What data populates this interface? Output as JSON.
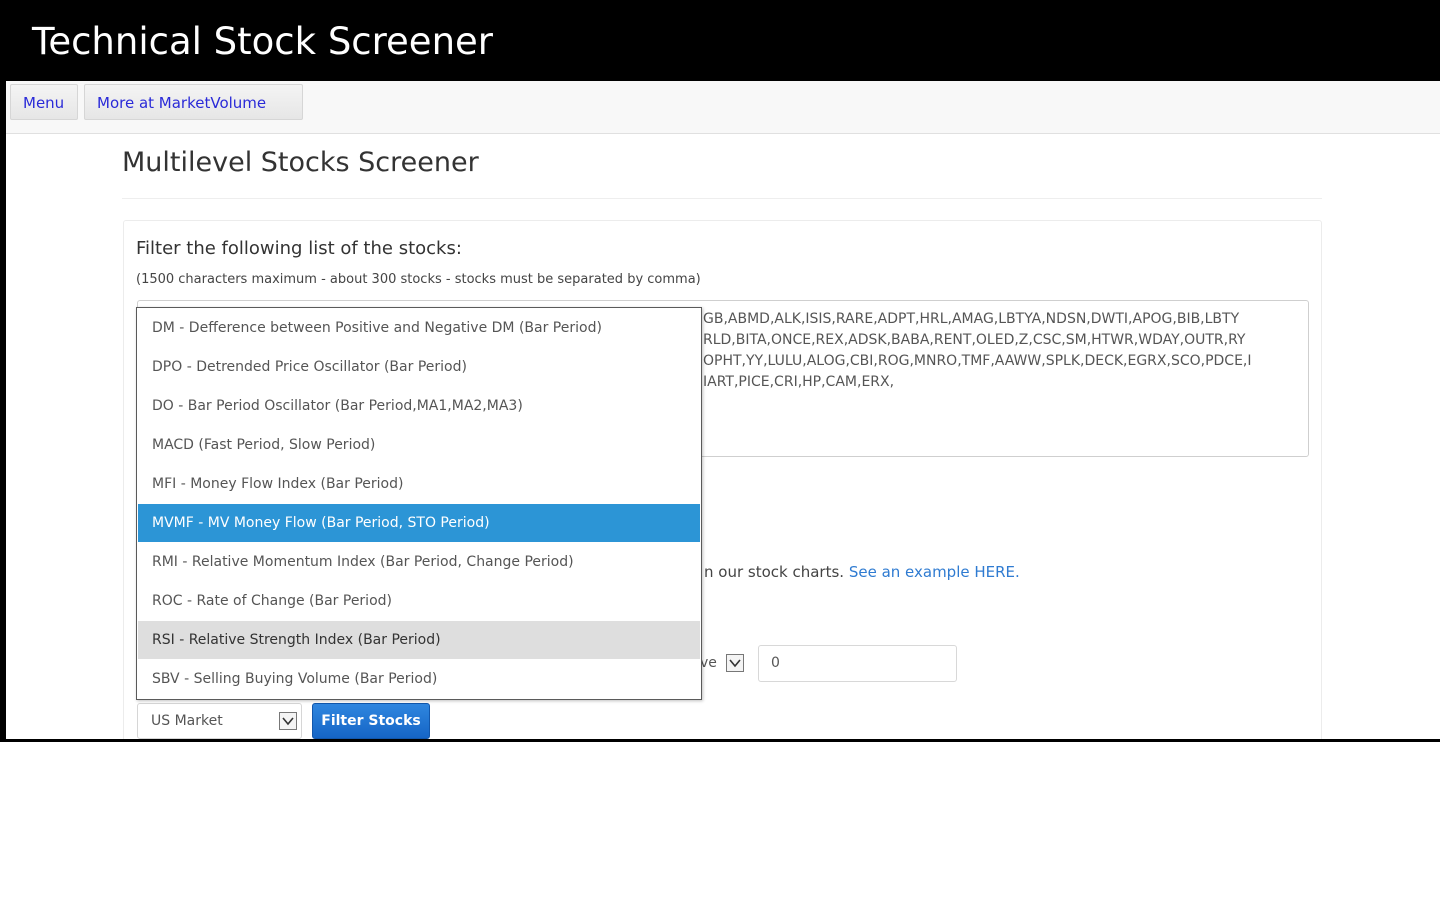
{
  "window": {
    "title": "Technical Stock Screener"
  },
  "nav": {
    "menu_label": "Menu",
    "more_label": "More at MarketVolume"
  },
  "page": {
    "heading": "Multilevel Stocks Screener",
    "filter_label": "Filter the following list of the stocks:",
    "filter_note": "(1500 characters maximum - about 300 stocks - stocks must be separated by comma)",
    "stock_list_visible": "GB,ABMD,ALK,ISIS,RARE,ADPT,HRL,AMAG,LBTYA,NDSN,DWTI,APOG,BIB,LBTY\nRLD,BITA,ONCE,REX,ADSK,BABA,RENT,OLED,Z,CSC,SM,HTWR,WDAY,OUTR,RY\nOPHT,YY,LULU,ALOG,CBI,ROG,MNRO,TMF,AAWW,SPLK,DECK,EGRX,SCO,PDCE,I\nIART,PICE,CRI,HP,CAM,ERX,"
  },
  "charts_line": {
    "text": "n our stock charts.",
    "link": "See an example HERE."
  },
  "condition": {
    "select_visible_text": "ve",
    "value": "0"
  },
  "market": {
    "selected": "US Market"
  },
  "filter_button": {
    "label": "Filter Stocks"
  },
  "indicator_dropdown": {
    "selected_index": 5,
    "hover_index": 8,
    "options": [
      "DM - Defference between Positive and Negative DM (Bar Period)",
      "DPO - Detrended Price Oscillator (Bar Period)",
      "DO - Bar Period Oscillator (Bar Period,MA1,MA2,MA3)",
      "MACD (Fast Period, Slow Period)",
      "MFI - Money Flow Index (Bar Period)",
      "MVMF - MV Money Flow (Bar Period, STO Period)",
      "RMI - Relative Momentum Index (Bar Period, Change Period)",
      "ROC - Rate of Change (Bar Period)",
      "RSI - Relative Strength Index (Bar Period)",
      "SBV - Selling Buying Volume (Bar Period)"
    ]
  },
  "colors": {
    "titlebar": "#000000",
    "selected_option": "#2c95d6",
    "hover_option": "#dedede",
    "primary_button": "#1f77d6",
    "link": "#2f7bd1",
    "nav_link": "#2a2ad8"
  },
  "icons": {
    "select_chevron": "chevron-down-icon"
  }
}
